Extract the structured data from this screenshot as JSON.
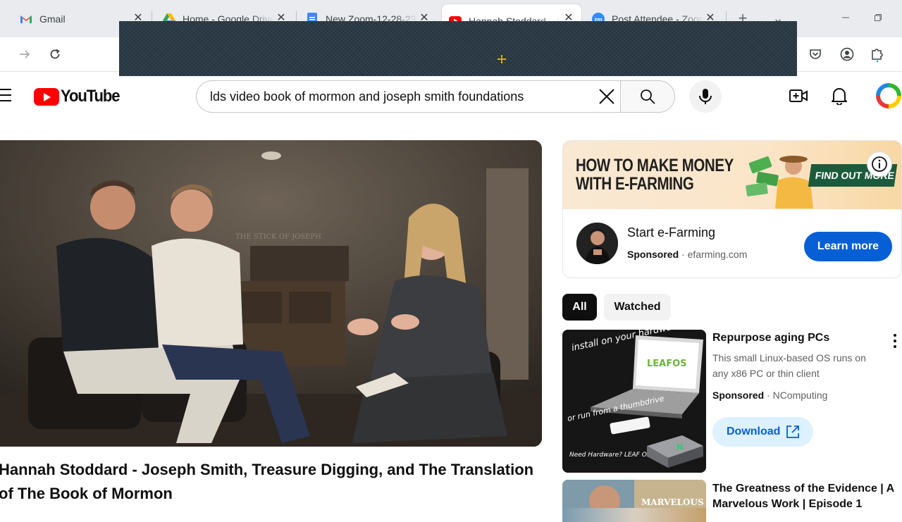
{
  "browser": {
    "tabs": [
      {
        "title": "Gmail",
        "icon": "gmail-icon",
        "active": false
      },
      {
        "title": "Home - Google Drive",
        "icon": "google-drive-icon",
        "active": false
      },
      {
        "title": "New Zoom-12-28-23",
        "icon": "google-docs-icon",
        "active": false
      },
      {
        "title": "Hannah Stoddard - Jo",
        "icon": "youtube-icon",
        "active": true
      },
      {
        "title": "Post Attendee - Zoom",
        "icon": "zoom-icon",
        "active": false
      }
    ],
    "new_tab_glyph": "+",
    "tab_list_glyph": "⌄"
  },
  "youtube": {
    "logo_text": "YouTube",
    "search_query": "lds video book of mormon and joseph smith foundations"
  },
  "video": {
    "title": "Hannah Stoddard - Joseph Smith, Treasure Digging, and The Translation of The Book of Mormon",
    "backdrop_text": "THE STICK OF JOSEPH"
  },
  "ad": {
    "banner_headline_line1": "HOW TO MAKE MONEY",
    "banner_headline_line2": "WITH E-FARMING",
    "banner_cta": "FIND OUT MORE",
    "title": "Start e-Farming",
    "sponsored_label": "Sponsored",
    "separator": "·",
    "domain": "efarming.com",
    "cta": "Learn more"
  },
  "chips": [
    {
      "label": "All",
      "active": true
    },
    {
      "label": "Watched",
      "active": false
    }
  ],
  "sponsored_item": {
    "title": "Repurpose aging PCs",
    "description": "This small Linux-based OS runs on any x86 PC or thin client",
    "sponsored_label": "Sponsored",
    "separator": "·",
    "advertiser": "NComputing",
    "cta": "Download",
    "thumb_text_1": "install on your hardware",
    "thumb_text_2": "or run from a thumbdrive",
    "thumb_text_3": "Need Hardware? LEAF OS is preinstalled",
    "thumb_logo": "LEAFOS"
  },
  "next_item": {
    "title": "The Greatness of the Evidence | A Marvelous Work | Episode 1",
    "thumb_text": "MARVELOUS"
  },
  "colors": {
    "youtube_red": "#ff0000",
    "link_blue": "#065fd4",
    "download_bg": "#def1ff"
  }
}
